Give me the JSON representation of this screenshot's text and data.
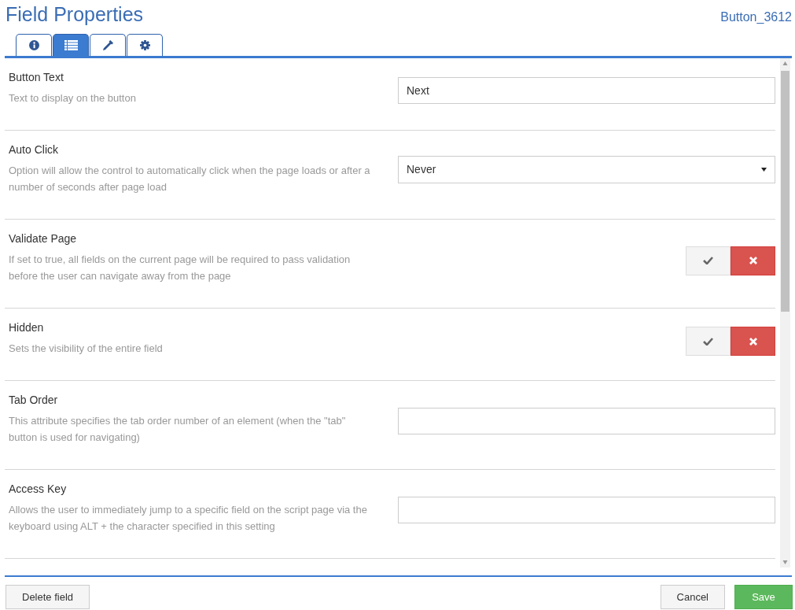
{
  "header": {
    "title": "Field Properties",
    "field_id": "Button_3612"
  },
  "tabs": [
    {
      "kind": "info",
      "selected": false
    },
    {
      "kind": "list",
      "selected": true
    },
    {
      "kind": "dropper",
      "selected": false
    },
    {
      "kind": "gear",
      "selected": false
    }
  ],
  "properties": [
    {
      "kind": "text",
      "label": "Button Text",
      "description": "Text to display on the button",
      "value": "Next"
    },
    {
      "kind": "select",
      "label": "Auto Click",
      "description": "Option will allow the control to automatically click when the page loads or after a number of seconds after page load",
      "value": "Never"
    },
    {
      "kind": "toggle",
      "label": "Validate Page",
      "description": "If set to true, all fields on the current page will be required to pass validation before the user can navigate away from the page",
      "on": false
    },
    {
      "kind": "toggle",
      "label": "Hidden",
      "description": "Sets the visibility of the entire field",
      "on": false
    },
    {
      "kind": "text",
      "label": "Tab Order",
      "description": "This attribute specifies the tab order number of an element (when the \"tab\" button is used for navigating)"
    },
    {
      "kind": "text",
      "label": "Access Key",
      "description": "Allows the user to immediately jump to a specific field on the script page via the keyboard using ALT + the character specified in this setting"
    }
  ],
  "footer": {
    "delete": "Delete field",
    "cancel": "Cancel",
    "save": "Save"
  }
}
